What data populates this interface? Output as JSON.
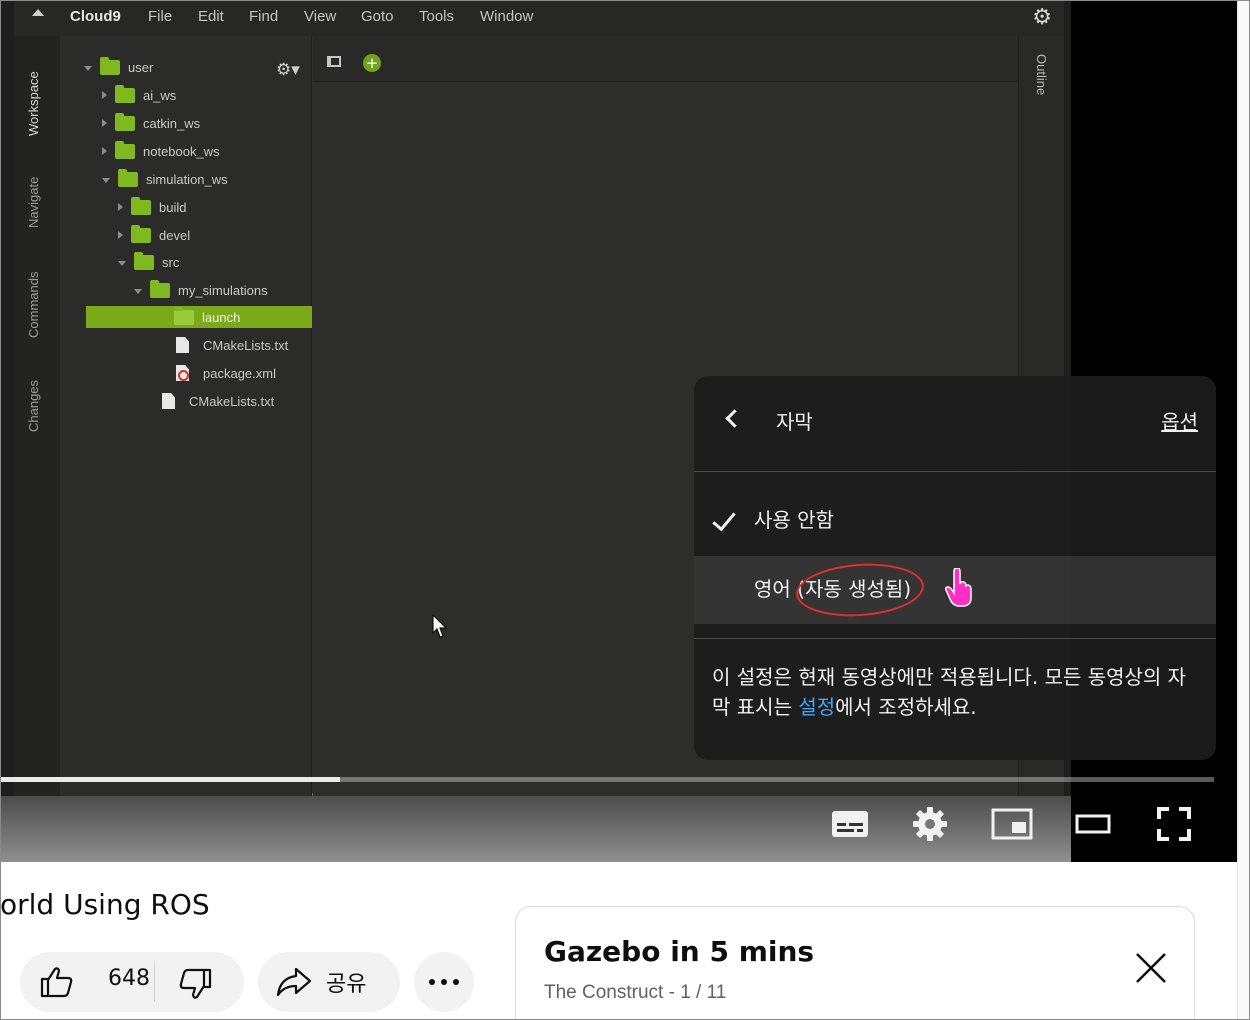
{
  "ide": {
    "brand": "Cloud9",
    "menu": [
      "File",
      "Edit",
      "Find",
      "View",
      "Goto",
      "Tools",
      "Window"
    ],
    "left_tabs": [
      "Workspace",
      "Navigate",
      "Commands",
      "Changes"
    ],
    "right_tab": "Outline",
    "tree": [
      {
        "label": "user",
        "kind": "folder",
        "state": "open"
      },
      {
        "label": "ai_ws",
        "kind": "folder",
        "state": "closed"
      },
      {
        "label": "catkin_ws",
        "kind": "folder",
        "state": "closed"
      },
      {
        "label": "notebook_ws",
        "kind": "folder",
        "state": "closed"
      },
      {
        "label": "simulation_ws",
        "kind": "folder",
        "state": "open"
      },
      {
        "label": "build",
        "kind": "folder",
        "state": "closed"
      },
      {
        "label": "devel",
        "kind": "folder",
        "state": "closed"
      },
      {
        "label": "src",
        "kind": "folder",
        "state": "open"
      },
      {
        "label": "my_simulations",
        "kind": "folder",
        "state": "open"
      },
      {
        "label": "launch",
        "kind": "folder",
        "state": "selected"
      },
      {
        "label": "CMakeLists.txt",
        "kind": "file"
      },
      {
        "label": "package.xml",
        "kind": "xml"
      },
      {
        "label": "CMakeLists.txt",
        "kind": "file"
      }
    ],
    "icons": {
      "menu_collapse": "chevron-up-icon",
      "settings": "gear-icon",
      "new_tab": "plus-icon",
      "tree_settings": "gear-icon"
    }
  },
  "player": {
    "progress": 0.28,
    "controls": [
      "subtitles-icon",
      "settings-gear-icon",
      "miniplayer-icon",
      "theater-mode-icon",
      "fullscreen-icon"
    ]
  },
  "subtitle_menu": {
    "title": "자막",
    "options_link": "옵션",
    "option_off": "사용 안함",
    "option_english": "영어 (자동 생성됨)",
    "note_before": "이 설정은 현재 동영상에만 적용됩니다. 모든 동영상의 자막 표시는 ",
    "note_link": "설정",
    "note_after": "에서 조정하세요.",
    "link_color": "#3ea6ff",
    "annotation_color": "#e0302c"
  },
  "video": {
    "title_fragment": "orld Using ROS",
    "likes": "648",
    "share": "공유"
  },
  "playlist": {
    "title": "Gazebo in 5 mins",
    "subtitle": "The Construct - 1 / 11"
  }
}
